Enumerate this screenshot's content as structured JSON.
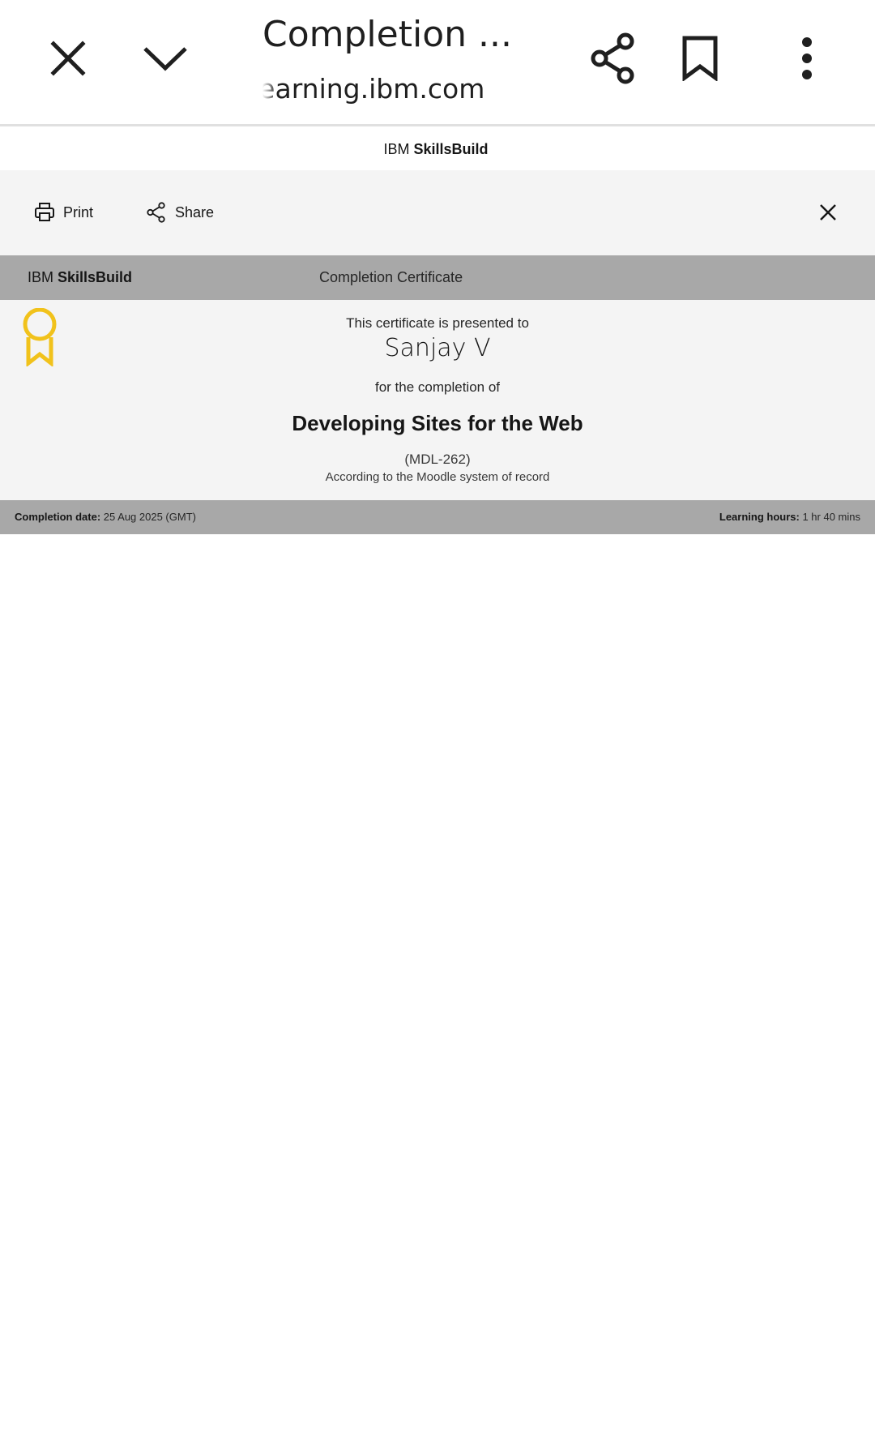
{
  "browser": {
    "title": "Completion ...",
    "url": "learning.ibm.com",
    "icons": {
      "close": "close-icon",
      "collapse": "chevron-down-icon",
      "share": "share-icon",
      "bookmark": "bookmark-icon",
      "more": "more-vert-icon"
    }
  },
  "site": {
    "brand_light": "IBM",
    "brand_bold": "SkillsBuild"
  },
  "toolbar": {
    "print_label": "Print",
    "share_label": "Share"
  },
  "certificate": {
    "brand_light": "IBM",
    "brand_bold": "SkillsBuild",
    "type": "Completion Certificate",
    "presented_text": "This certificate is presented to",
    "recipient": "Sanjay V",
    "for_text": "for the completion of",
    "course": "Developing Sites for the Web",
    "course_code": "(MDL-262)",
    "record_text": "According to the Moodle system of record",
    "completion_label": "Completion date:",
    "completion_value": "25 Aug 2025 (GMT)",
    "hours_label": "Learning hours:",
    "hours_value": "1 hr 40 mins",
    "ribbon_color": "#f1c21b"
  }
}
